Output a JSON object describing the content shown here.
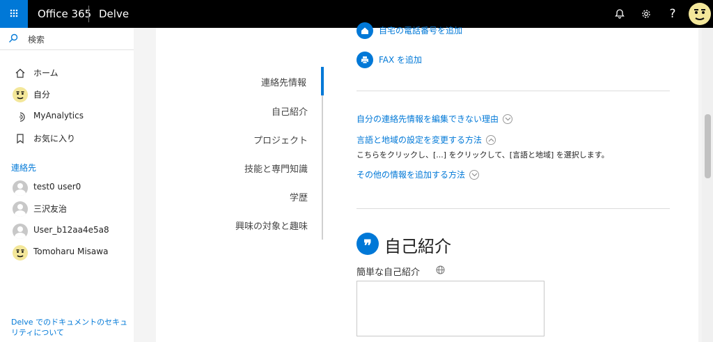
{
  "topbar": {
    "app_name": "Office 365",
    "app_sub": "Delve",
    "icons": [
      "bell-icon",
      "gear-icon",
      "help-icon"
    ],
    "colors": {
      "bar": "#000000",
      "waffle": "#0078d7"
    }
  },
  "sidebar": {
    "search_label": "検索",
    "nav": [
      {
        "label": "ホーム",
        "icon": "home-icon"
      },
      {
        "label": "自分",
        "icon": "avatar"
      },
      {
        "label": "MyAnalytics",
        "icon": "analytics-icon"
      },
      {
        "label": "お気に入り",
        "icon": "bookmark-icon"
      }
    ],
    "contacts_heading": "連絡先",
    "contacts": [
      {
        "name": "test0 user0"
      },
      {
        "name": "三沢友治"
      },
      {
        "name": "User_b12aa4e5a8"
      },
      {
        "name": "Tomoharu Misawa"
      }
    ],
    "footer_link": "Delve でのドキュメントのセキュリティについて"
  },
  "toc": {
    "items": [
      "連絡先情報",
      "自己紹介",
      "プロジェクト",
      "技能と専門知識",
      "学歴",
      "興味の対象と趣味"
    ],
    "active": "連絡先情報"
  },
  "contact": {
    "home_phone_link": "自宅の電話番号を追加",
    "fax_link": "FAX を追加",
    "why_cant_edit": "自分の連絡先情報を編集できない理由",
    "how_change_region": "言語と地域の設定を変更する方法",
    "region_instruction": "こちらをクリックし、[...] をクリックして、[言語と地域] を選択します。",
    "how_add_more": "その他の情報を追加する方法"
  },
  "about": {
    "title": "自己紹介",
    "field_label": "簡単な自己紹介",
    "field_value": ""
  },
  "accent_color": "#0078d7"
}
